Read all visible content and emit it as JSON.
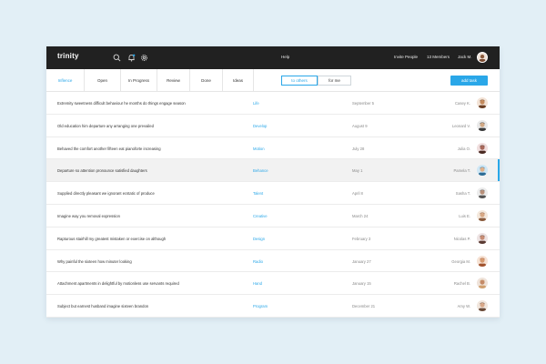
{
  "brand": "trinity",
  "topbar": {
    "help": "Help",
    "invite": "Invite People",
    "members": "13 Members",
    "user": "Jack M.",
    "icons": [
      "search-icon",
      "bell-icon",
      "gear-icon"
    ]
  },
  "tabs": [
    {
      "label": "Inflence",
      "active": true
    },
    {
      "label": "Open",
      "active": false
    },
    {
      "label": "In Progress",
      "active": false
    },
    {
      "label": "Review",
      "active": false
    },
    {
      "label": "Done",
      "active": false
    },
    {
      "label": "Ideas",
      "active": false
    }
  ],
  "filter": {
    "to_others": "to others",
    "for_me": "for me",
    "selected": "to others"
  },
  "add_task": "add task",
  "colors": {
    "accent": "#2aa7e8",
    "topbar": "#212121",
    "background": "#e2eff6"
  },
  "rows": [
    {
      "title": "Extremity sweetness difficult behaviour he months do things engage season",
      "tag": "Life",
      "date": "September 5",
      "person": "Casey K.",
      "highlighted": false
    },
    {
      "title": "Old education him departure any arranging one prevailed",
      "tag": "Develop",
      "date": "August 9",
      "person": "Leonard V.",
      "highlighted": false
    },
    {
      "title": "Behaved the comfort another fifteen eat pianoforte increasing",
      "tag": "Motion",
      "date": "July 28",
      "person": "Julia O.",
      "highlighted": false
    },
    {
      "title": "Departure so attention pronounce satisfied daughters",
      "tag": "Behance",
      "date": "May 1",
      "person": "Pamela T.",
      "highlighted": true
    },
    {
      "title": "Supplied directly pleasant we ignorant ecstatic of produce",
      "tag": "Talent",
      "date": "April 8",
      "person": "Sasha T.",
      "highlighted": false
    },
    {
      "title": "Imagine way you removal expression",
      "tag": "Creative",
      "date": "March 24",
      "person": "Luis E.",
      "highlighted": false
    },
    {
      "title": "Rapturous stairhill my greatest mistaken or exercise on although",
      "tag": "Design",
      "date": "February 3",
      "person": "Nicolas P.",
      "highlighted": false
    },
    {
      "title": "Why painful the sixteen how minuter looking",
      "tag": "Radio",
      "date": "January 27",
      "person": "Georgia M.",
      "highlighted": false
    },
    {
      "title": "Attachment apartments in delightful by motionless use servants required",
      "tag": "Hand",
      "date": "January 15",
      "person": "Rachel B.",
      "highlighted": false
    },
    {
      "title": "Subject but earnest husband imagine sixteen brandon",
      "tag": "Program",
      "date": "December 21",
      "person": "Amy W.",
      "highlighted": false
    }
  ]
}
